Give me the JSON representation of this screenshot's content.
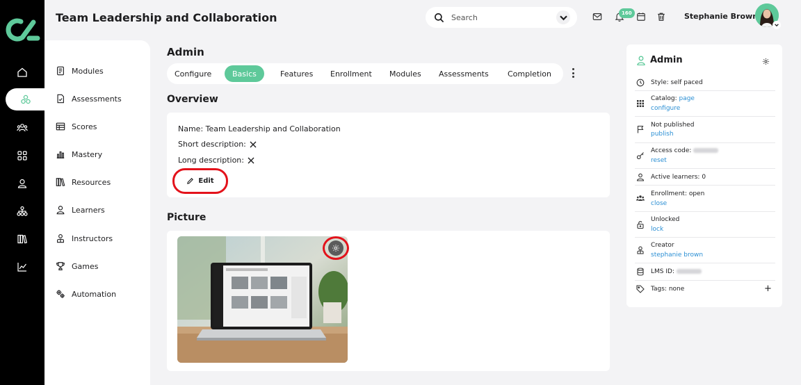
{
  "app": {
    "title": "Team Leadership and Collaboration",
    "search_placeholder": "Search",
    "notifications_count": "160",
    "user_name": "Stephanie Brown",
    "accent_color": "#5ec99a"
  },
  "rail": {
    "items": [
      {
        "icon": "home-icon"
      },
      {
        "icon": "courses-icon",
        "active": true
      },
      {
        "icon": "groups-icon"
      },
      {
        "icon": "apps-grid-icon"
      },
      {
        "icon": "user-icon"
      },
      {
        "icon": "org-chart-icon"
      },
      {
        "icon": "library-icon"
      },
      {
        "icon": "analytics-icon"
      }
    ]
  },
  "sidemenu": {
    "items": [
      {
        "label": "Modules",
        "icon": "modules-icon"
      },
      {
        "label": "Assessments",
        "icon": "assessments-icon"
      },
      {
        "label": "Scores",
        "icon": "scores-icon"
      },
      {
        "label": "Mastery",
        "icon": "mastery-icon"
      },
      {
        "label": "Resources",
        "icon": "resources-icon"
      },
      {
        "label": "Learners",
        "icon": "learners-icon"
      },
      {
        "label": "Instructors",
        "icon": "instructors-icon"
      },
      {
        "label": "Games",
        "icon": "games-icon"
      },
      {
        "label": "Automation",
        "icon": "automation-icon"
      }
    ]
  },
  "main": {
    "heading": "Admin",
    "tabs": [
      "Configure",
      "Basics",
      "Features",
      "Enrollment",
      "Modules",
      "Assessments",
      "Completion"
    ],
    "active_tab": "Basics",
    "overview": {
      "title": "Overview",
      "name_line": "Name: Team Leadership and Collaboration",
      "short_desc_label": "Short description:",
      "long_desc_label": "Long description:",
      "edit_label": "Edit"
    },
    "picture": {
      "title": "Picture"
    }
  },
  "info": {
    "title": "Admin",
    "style": "Style: self paced",
    "catalog_label": "Catalog:",
    "catalog_link": "page",
    "catalog_configure": "configure",
    "published_status": "Not published",
    "publish_link": "publish",
    "access_code_label": "Access code:",
    "access_reset": "reset",
    "active_learners": "Active learners: 0",
    "enrollment_status": "Enrollment: open",
    "enrollment_link": "close",
    "lock_status": "Unlocked",
    "lock_link": "lock",
    "creator_label": "Creator",
    "creator_name": "stephanie brown",
    "lms_id_label": "LMS ID:",
    "tags": "Tags: none",
    "add_tag": "+"
  }
}
